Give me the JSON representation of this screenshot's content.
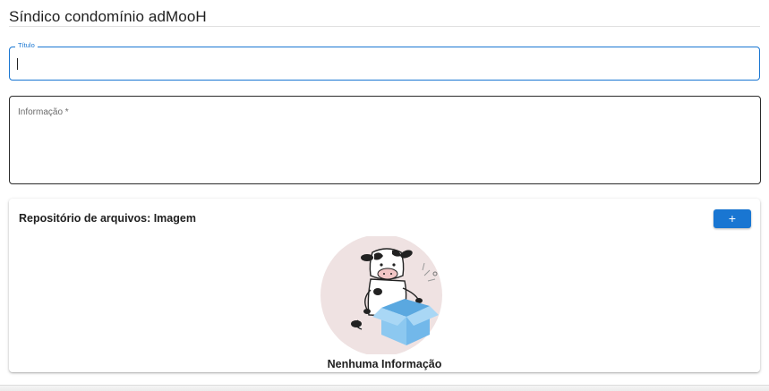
{
  "header": {
    "title": "Síndico condomínio adMooH"
  },
  "form": {
    "titulo": {
      "label": "Título",
      "value": ""
    },
    "informacao": {
      "label": "Informação *",
      "value": ""
    }
  },
  "repository": {
    "title": "Repositório de arquivos: Imagem",
    "add_label": "+",
    "empty_message": "Nenhuma Informação",
    "illustration_icon": "cow-with-open-box"
  },
  "colors": {
    "primary": "#1976d2",
    "box": "#8cc8f0",
    "blob": "#efe2e2"
  }
}
